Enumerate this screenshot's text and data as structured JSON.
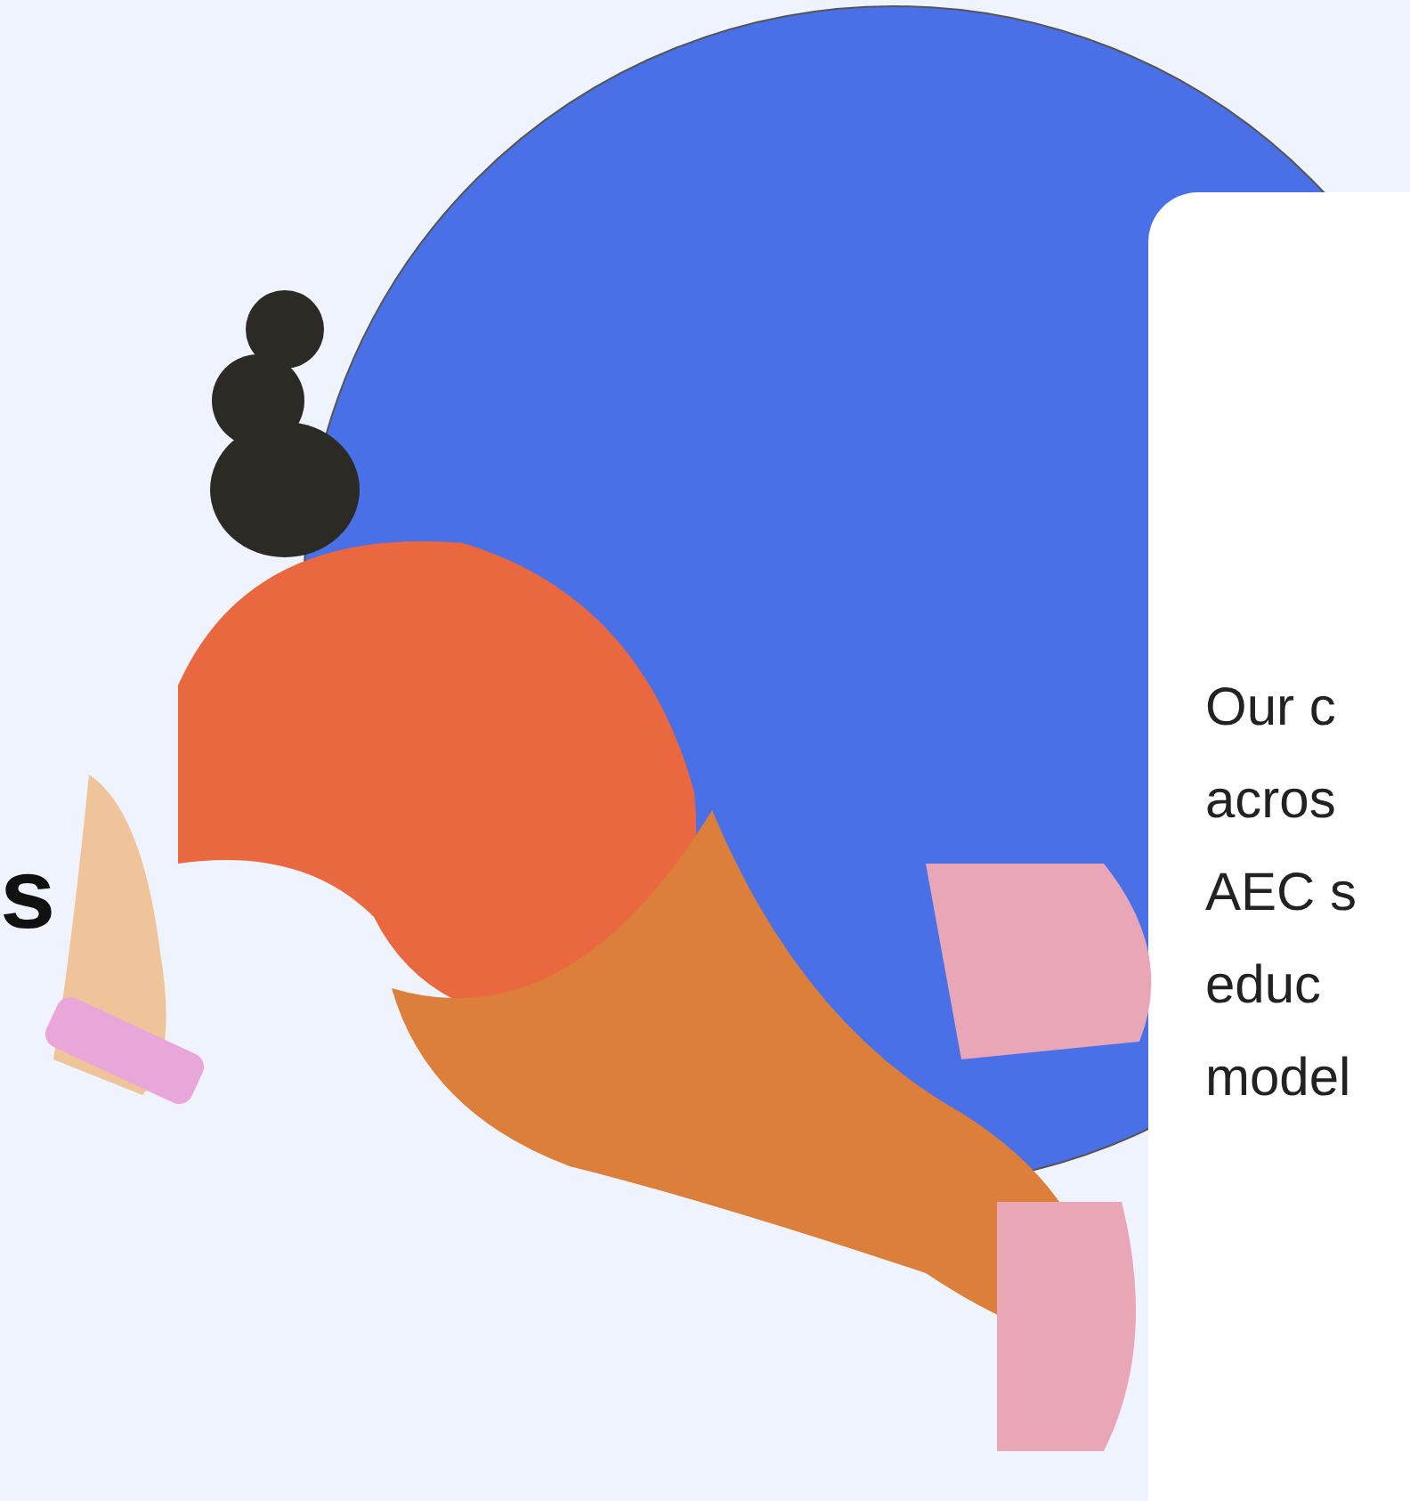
{
  "heading_fragment": "s",
  "card": {
    "text_lines": [
      "Our c",
      "acros",
      "AEC s",
      "educ",
      "model"
    ]
  }
}
